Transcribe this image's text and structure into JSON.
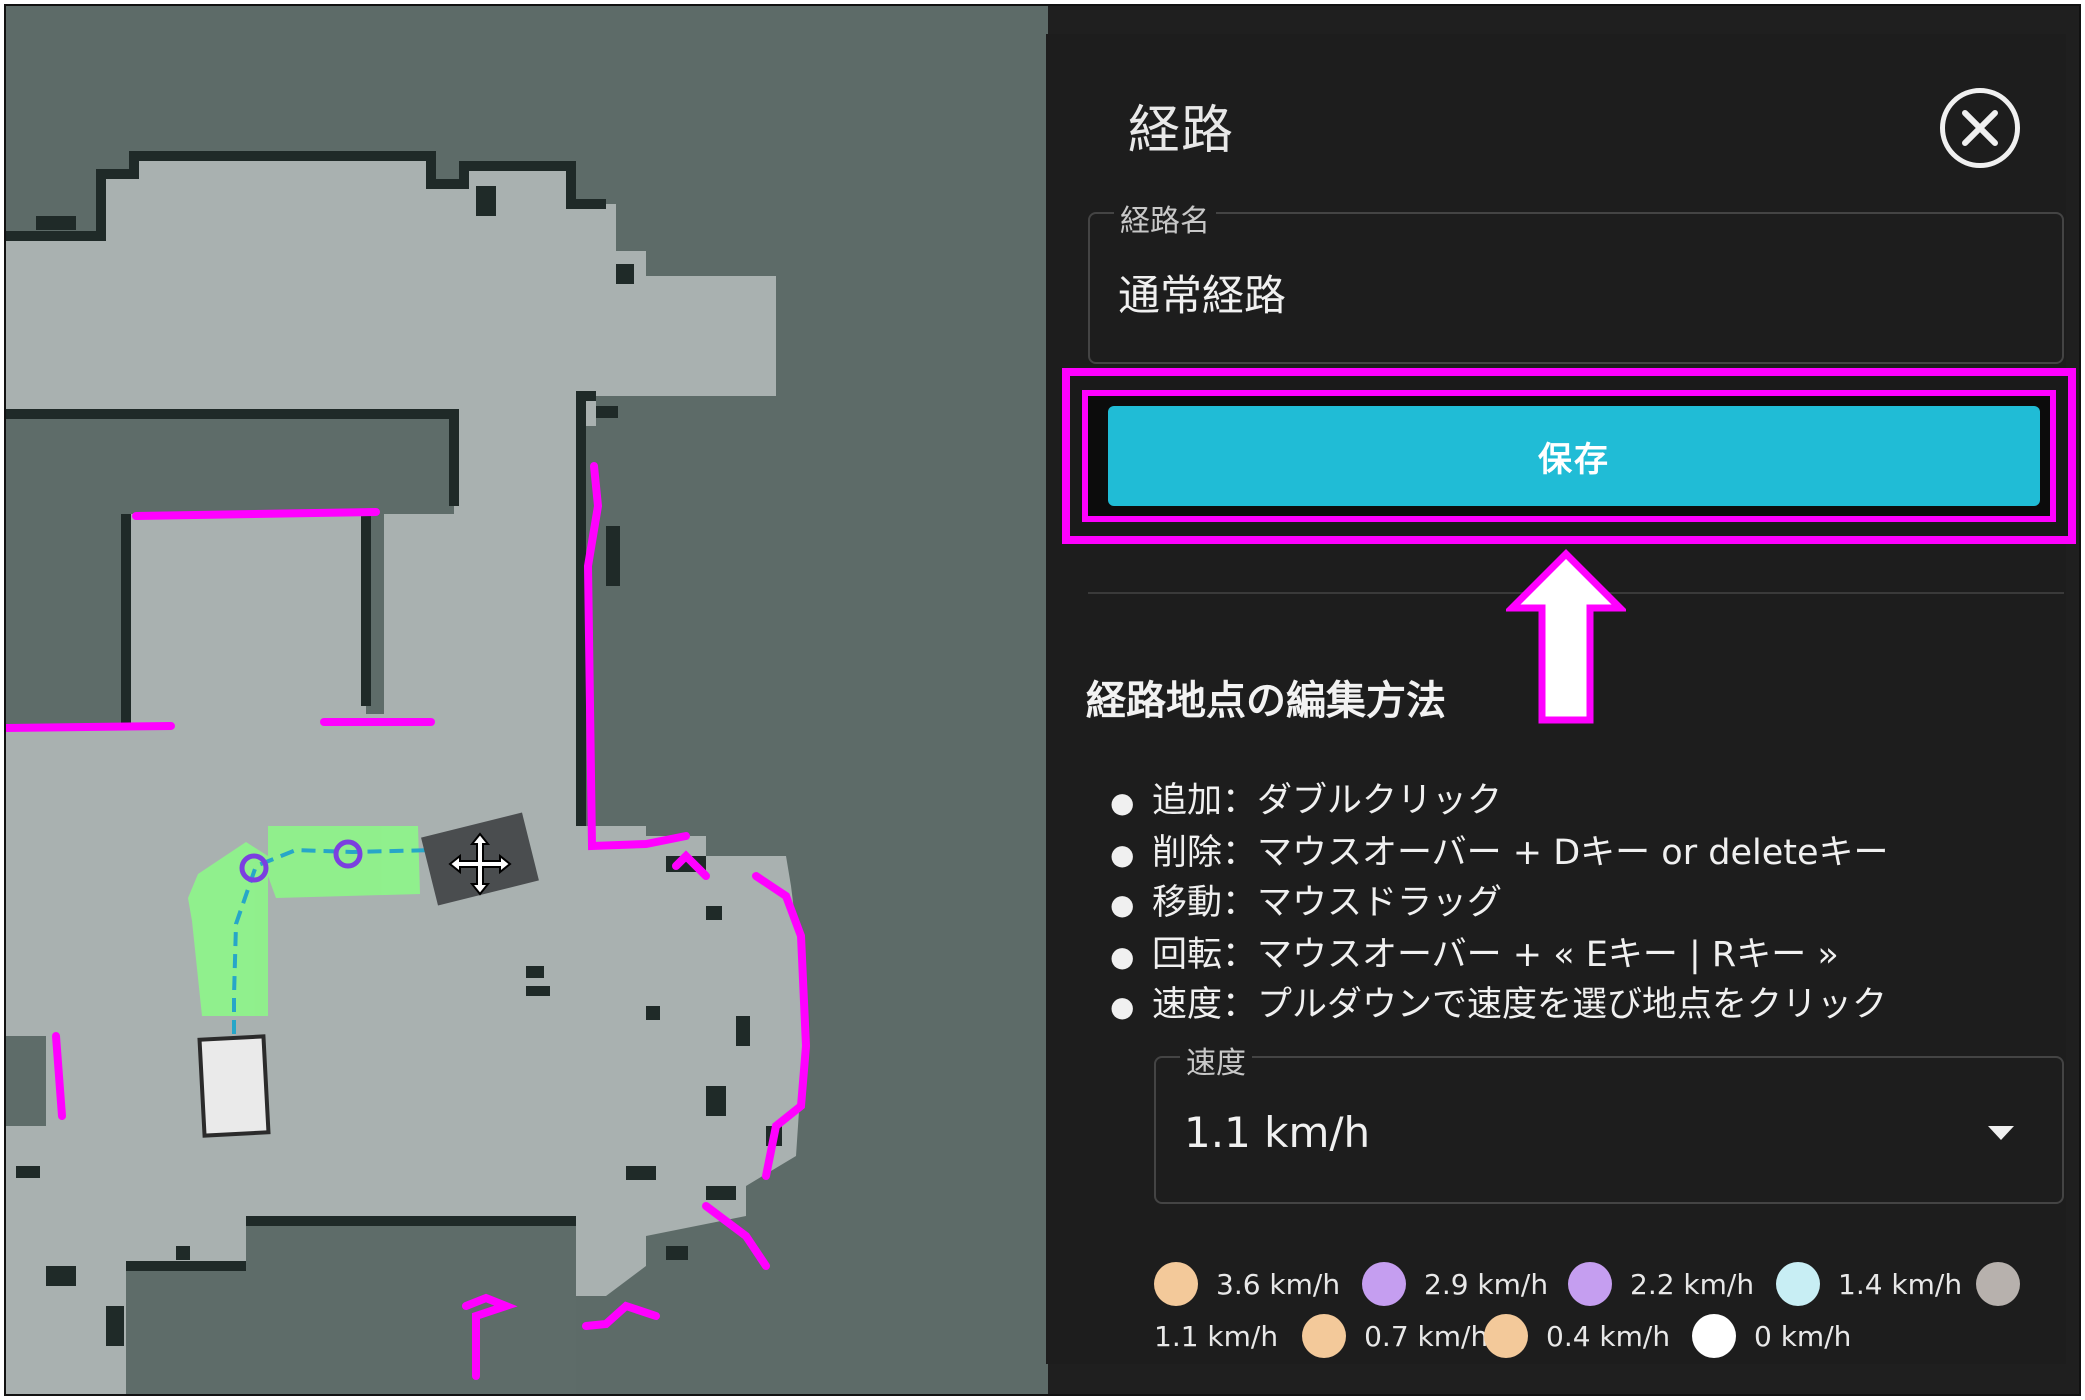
{
  "panel": {
    "title": "経路",
    "route_name_label": "経路名",
    "route_name_value": "通常経路",
    "save_label": "保存",
    "edit_section_title": "経路地点の編集方法",
    "instructions": [
      "追加：ダブルクリック",
      "削除：マウスオーバー + Dキー or deleteキー",
      "移動：マウスドラッグ",
      "回転：マウスオーバー + « Eキー | Rキー »",
      "速度：プルダウンで速度を選び地点をクリック"
    ],
    "speed_label": "速度",
    "speed_value": "1.1 km/h",
    "speed_legend": [
      {
        "label": "3.6 km/h",
        "color": "#f3c99a"
      },
      {
        "label": "2.9 km/h",
        "color": "#c59ef0"
      },
      {
        "label": "2.2 km/h",
        "color": "#c59ef0"
      },
      {
        "label": "1.4 km/h",
        "color": "#c8eef4"
      },
      {
        "label": "1.1 km/h",
        "color": "#b7b1ad"
      },
      {
        "label": "0.7 km/h",
        "color": "#f3c99a"
      },
      {
        "label": "0.4 km/h",
        "color": "#f3c99a"
      },
      {
        "label": "0 km/h",
        "color": "#ffffff"
      }
    ]
  },
  "colors": {
    "accent": "#20bcd6",
    "highlight": "#ff00ff",
    "panel_bg": "#1d1d1d",
    "map_free": "#a9b1b0",
    "map_unknown": "#5e6c69",
    "map_wall": "#1f2a28",
    "route_segment": "#8ef58a"
  }
}
